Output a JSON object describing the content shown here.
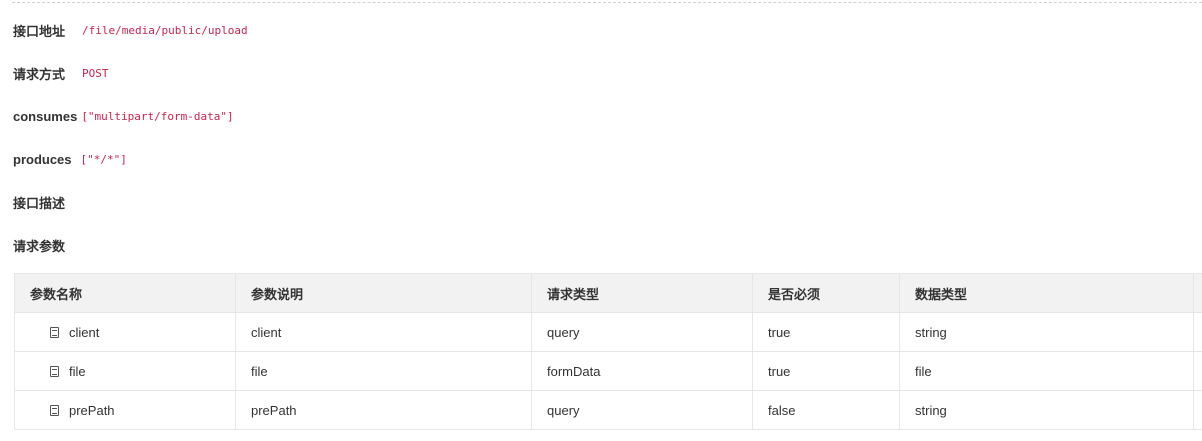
{
  "info": {
    "address": {
      "label": "接口地址",
      "value": "/file/media/public/upload"
    },
    "method": {
      "label": "请求方式",
      "value": "POST"
    },
    "consumes": {
      "label": "consumes",
      "value": "[\"multipart/form-data\"]"
    },
    "produces": {
      "label": "produces",
      "value": "[\"*/*\"]"
    },
    "description": {
      "label": "接口描述"
    },
    "params_heading": "请求参数"
  },
  "table": {
    "headers": [
      "参数名称",
      "参数说明",
      "请求类型",
      "是否必须",
      "数据类型"
    ],
    "rows": [
      {
        "name": "client",
        "desc": "client",
        "in": "query",
        "required": "true",
        "type": "string"
      },
      {
        "name": "file",
        "desc": "file",
        "in": "formData",
        "required": "true",
        "type": "file"
      },
      {
        "name": "prePath",
        "desc": "prePath",
        "in": "query",
        "required": "false",
        "type": "string"
      }
    ]
  },
  "colors": {
    "code": "#c7254e",
    "query": "#55a8fd",
    "formData": "#a23de4",
    "required_true": "#d01a1a",
    "header_bg": "#f2f2f2"
  },
  "icons": {
    "row_icon": "document-list-icon"
  }
}
